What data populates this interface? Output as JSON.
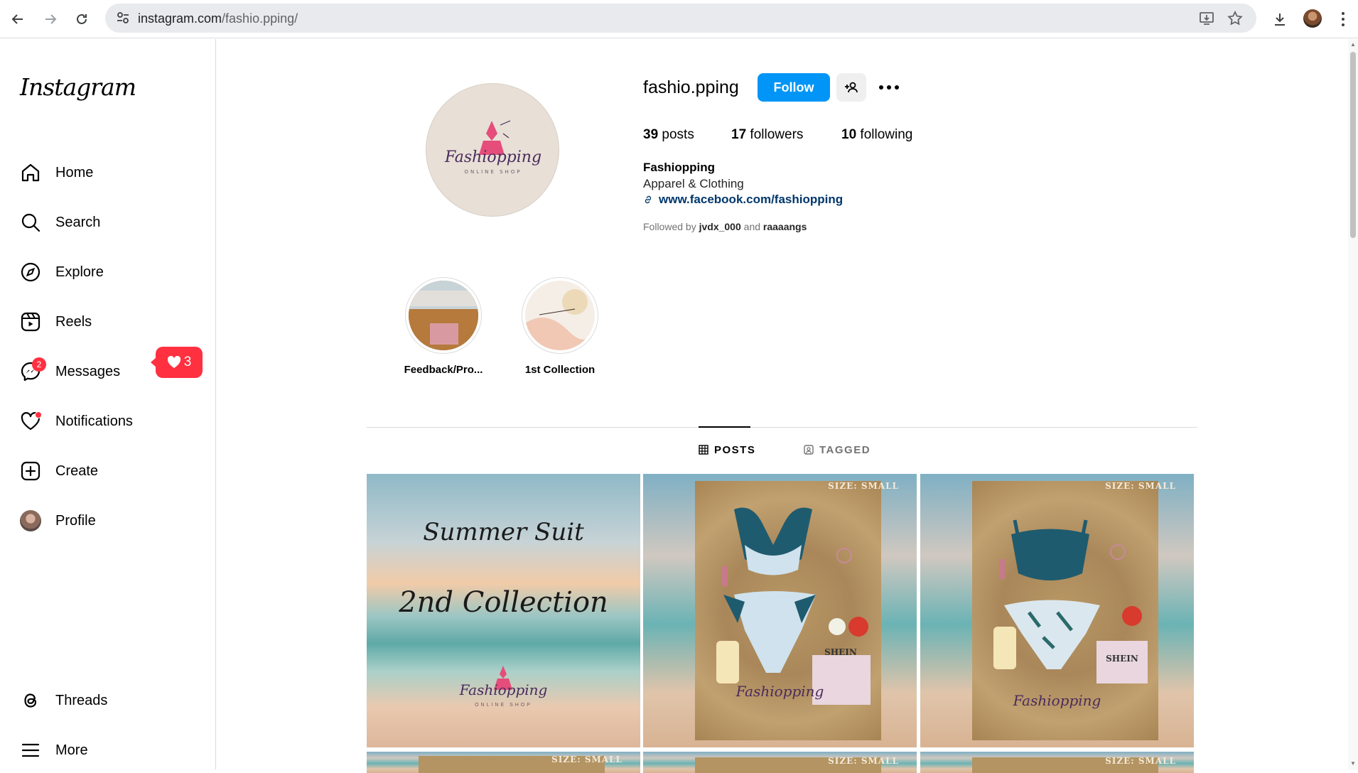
{
  "browser": {
    "url_host": "instagram.com",
    "url_path": "/fashio.pping/"
  },
  "sidebar": {
    "logo": "Instagram",
    "items": [
      {
        "label": "Home",
        "icon": "home-icon"
      },
      {
        "label": "Search",
        "icon": "search-icon"
      },
      {
        "label": "Explore",
        "icon": "compass-icon"
      },
      {
        "label": "Reels",
        "icon": "reels-icon"
      },
      {
        "label": "Messages",
        "icon": "messenger-icon",
        "badge": "2"
      },
      {
        "label": "Notifications",
        "icon": "heart-icon"
      },
      {
        "label": "Create",
        "icon": "plus-square-icon"
      },
      {
        "label": "Profile",
        "icon": "avatar"
      },
      {
        "label": "Threads",
        "icon": "threads-icon"
      },
      {
        "label": "More",
        "icon": "menu-icon"
      }
    ],
    "notifications_popup_count": "3"
  },
  "profile": {
    "username": "fashio.pping",
    "follow_label": "Follow",
    "posts_count": "39",
    "posts_label": "posts",
    "followers_count": "17",
    "followers_label": "followers",
    "following_count": "10",
    "following_label": "following",
    "full_name": "Fashiopping",
    "category": "Apparel & Clothing",
    "link": "www.facebook.com/fashiopping",
    "followed_by_prefix": "Followed by",
    "followed_by_user1": "jvdx_000",
    "followed_by_and": "and",
    "followed_by_user2": "raaaangs",
    "logo_text": "Fashiopping",
    "logo_subtext": "ONLINE SHOP"
  },
  "highlights": [
    {
      "label": "Feedback/Pro..."
    },
    {
      "label": "1st Collection"
    }
  ],
  "tabs": [
    {
      "label": "POSTS",
      "active": true
    },
    {
      "label": "TAGGED",
      "active": false
    }
  ],
  "posts": [
    {
      "line1": "Summer Suit",
      "line2": "2nd Collection",
      "brand": "Fashiopping",
      "brand_sub": "ONLINE SHOP"
    },
    {
      "size_label": "SIZE: SMALL",
      "brand": "Fashiopping",
      "tag": "SHEIN"
    },
    {
      "size_label": "SIZE: SMALL",
      "brand": "Fashiopping",
      "tag": "SHEIN"
    }
  ],
  "posts_row2": [
    {
      "size_label": "SIZE: SMALL"
    },
    {
      "size_label": "SIZE: SMALL"
    },
    {
      "size_label": "SIZE: SMALL"
    }
  ],
  "colors": {
    "follow_blue": "#0095f6",
    "badge_red": "#ff3040",
    "link_blue": "#00376b"
  }
}
